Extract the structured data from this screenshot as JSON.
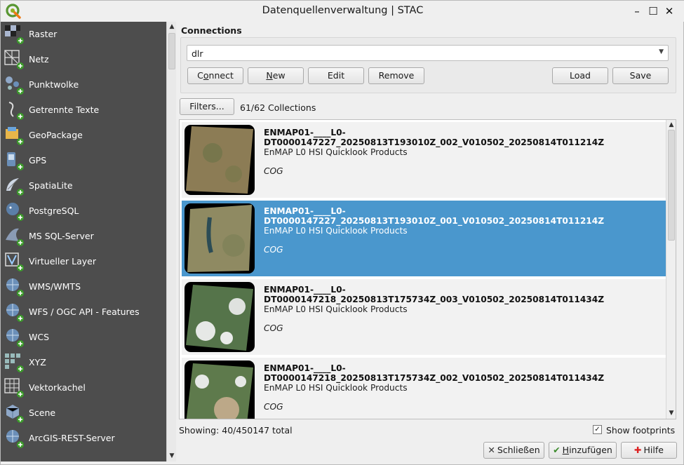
{
  "window": {
    "title": "Datenquellenverwaltung | STAC",
    "minimize": "–",
    "maximize": "☐",
    "close": "✕"
  },
  "sidebar": {
    "items": [
      {
        "label": "Raster",
        "icon": "raster-icon"
      },
      {
        "label": "Netz",
        "icon": "mesh-icon"
      },
      {
        "label": "Punktwolke",
        "icon": "point-cloud-icon"
      },
      {
        "label": "Getrennte Texte",
        "icon": "delimited-text-icon"
      },
      {
        "label": "GeoPackage",
        "icon": "geopackage-icon"
      },
      {
        "label": "GPS",
        "icon": "gps-icon"
      },
      {
        "label": "SpatiaLite",
        "icon": "spatialite-icon"
      },
      {
        "label": "PostgreSQL",
        "icon": "postgresql-icon"
      },
      {
        "label": "MS SQL-Server",
        "icon": "mssql-icon"
      },
      {
        "label": "Virtueller Layer",
        "icon": "virtual-layer-icon"
      },
      {
        "label": "WMS/WMTS",
        "icon": "wms-icon"
      },
      {
        "label": "WFS / OGC API - Features",
        "icon": "wfs-icon"
      },
      {
        "label": "WCS",
        "icon": "wcs-icon"
      },
      {
        "label": "XYZ",
        "icon": "xyz-icon"
      },
      {
        "label": "Vektorkachel",
        "icon": "vector-tile-icon"
      },
      {
        "label": "Scene",
        "icon": "scene-icon"
      },
      {
        "label": "ArcGIS-REST-Server",
        "icon": "arcgis-rest-icon"
      }
    ]
  },
  "connections": {
    "heading": "Connections",
    "selected": "dlr",
    "buttons": {
      "connect_pre": "C",
      "connect_u": "o",
      "connect_post": "nnect",
      "new_u": "N",
      "new_post": "ew",
      "edit": "Edit",
      "remove": "Remove",
      "load": "Load",
      "save": "Save"
    }
  },
  "filters": {
    "button": "Filters...",
    "count": "61/62 Collections"
  },
  "results": [
    {
      "title": "ENMAP01-____L0-DT0000147227_20250813T193010Z_002_V010502_20250814T011214Z",
      "description": "EnMAP L0 HSI Quicklook Products",
      "tag": "COG",
      "selected": false
    },
    {
      "title": "ENMAP01-____L0-DT0000147227_20250813T193010Z_001_V010502_20250814T011214Z",
      "description": "EnMAP L0 HSI Quicklook Products",
      "tag": "COG",
      "selected": true
    },
    {
      "title": "ENMAP01-____L0-DT0000147218_20250813T175734Z_003_V010502_20250814T011434Z",
      "description": "EnMAP L0 HSI Quicklook Products",
      "tag": "COG",
      "selected": false
    },
    {
      "title": "ENMAP01-____L0-DT0000147218_20250813T175734Z_002_V010502_20250814T011434Z",
      "description": "EnMAP L0 HSI Quicklook Products",
      "tag": "COG",
      "selected": false
    }
  ],
  "footer": {
    "status": "Showing: 40/450147 total",
    "show_footprints": "Show footprints",
    "show_footprints_checked": true,
    "close_label": "Schließen",
    "add_pre": "",
    "add_u": "H",
    "add_post": "inzufügen",
    "help_label": "Hilfe"
  },
  "colors": {
    "sidebar_bg": "#4d4d4d",
    "selection": "#4a97cd"
  }
}
